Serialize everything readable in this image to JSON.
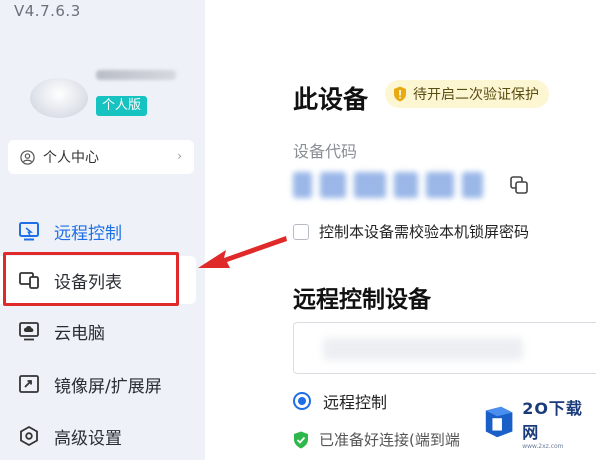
{
  "app": {
    "version": "V4.7.6.3"
  },
  "account": {
    "edition_badge": "个人版",
    "user_center_label": "个人中心",
    "chevron": "›"
  },
  "sidebar": {
    "items": [
      {
        "label": "远程控制",
        "icon": "remote-control-icon",
        "state": "active"
      },
      {
        "label": "设备列表",
        "icon": "device-list-icon",
        "state": "selected"
      },
      {
        "label": "云电脑",
        "icon": "cloud-pc-icon",
        "state": "normal"
      },
      {
        "label": "镜像屏/扩展屏",
        "icon": "mirror-screen-icon",
        "state": "normal"
      },
      {
        "label": "高级设置",
        "icon": "settings-icon",
        "state": "normal"
      }
    ]
  },
  "main": {
    "this_device_title": "此设备",
    "twofa_badge": "待开启二次验证保护",
    "device_code_label": "设备代码",
    "lock_password_checkbox": "控制本设备需校验本机锁屏密码",
    "remote_title": "远程控制设备",
    "remote_option": "远程控制",
    "status_text": "已准备好连接(端到端"
  },
  "watermark": {
    "title": "2O下载网",
    "url": "www.2xz.com"
  },
  "colors": {
    "accent": "#1e6fe6",
    "sidebar_bg": "#eef2f8",
    "highlight": "#e02a2a",
    "badge_teal": "#17c3c0",
    "warning_bg": "#fdf6d2",
    "status_green": "#2eb84b"
  }
}
